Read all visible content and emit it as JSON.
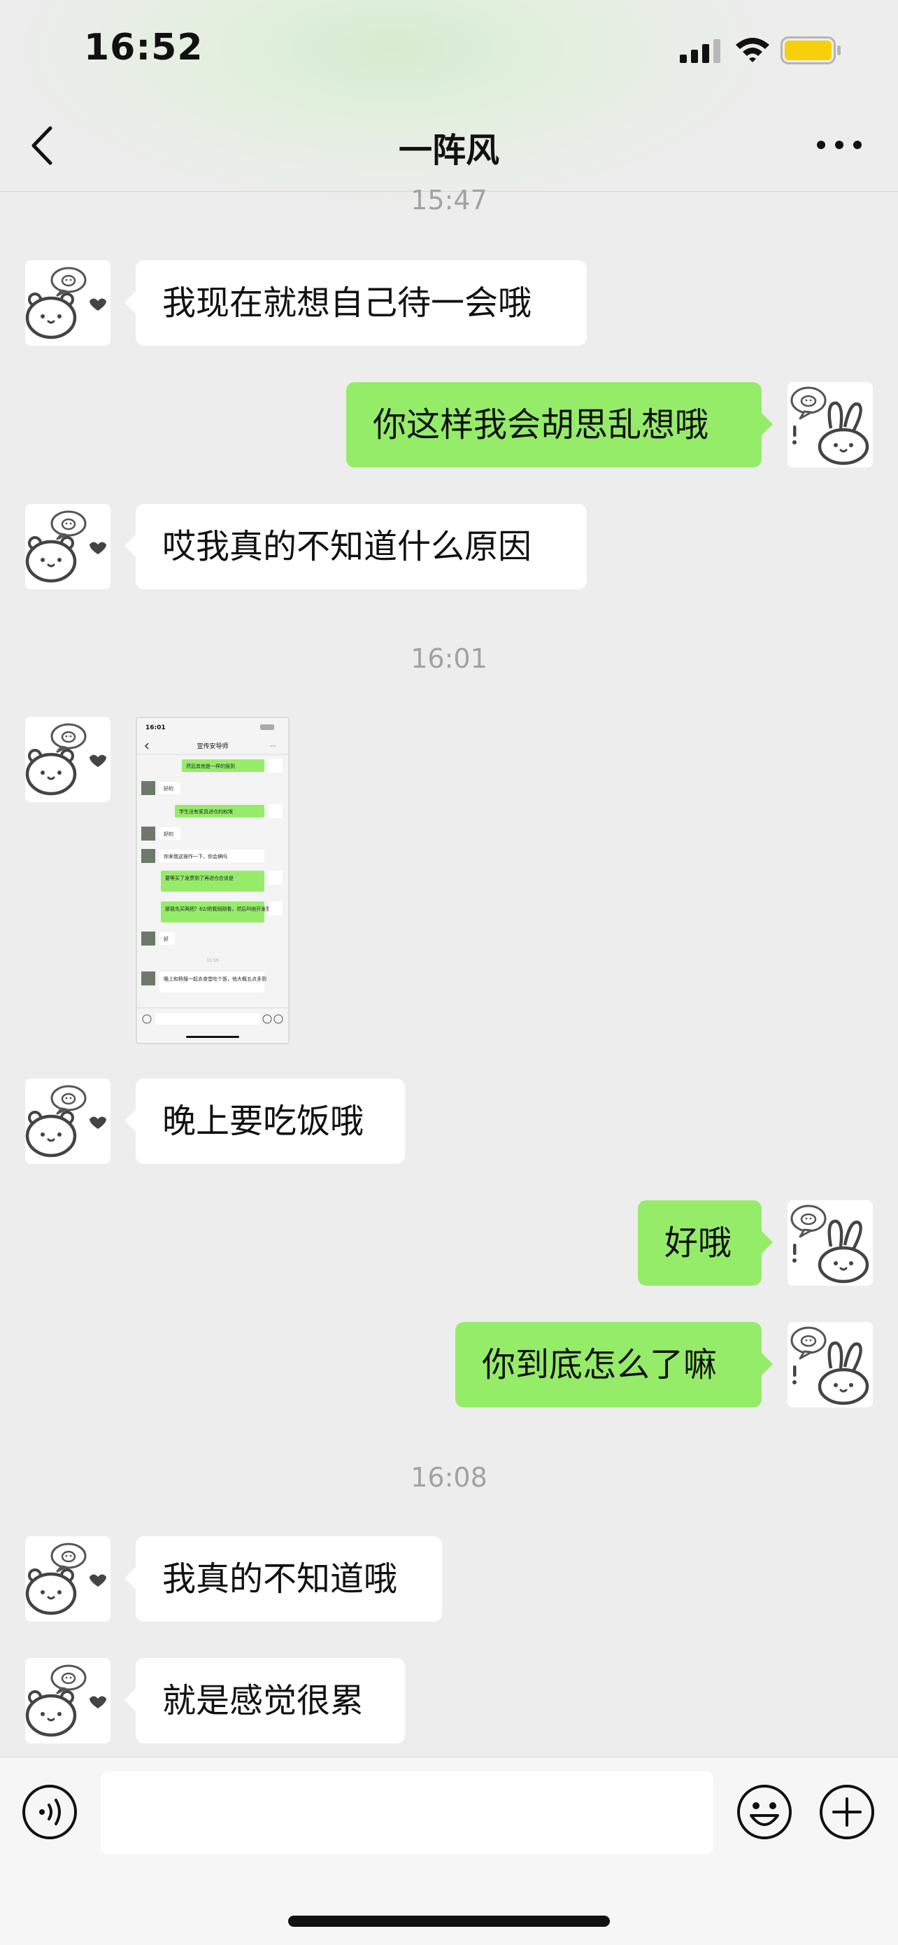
{
  "status_bar": {
    "time": "16:52"
  },
  "header": {
    "title": "一阵风"
  },
  "colors": {
    "incoming_bubble": "#ffffff",
    "outgoing_bubble": "#95ec69",
    "background": "#ededed",
    "timestamp": "#a2a2a2"
  },
  "messages": [
    {
      "type": "timestamp",
      "text": "15:47"
    },
    {
      "type": "incoming",
      "text": "我现在就想自己待一会哦"
    },
    {
      "type": "outgoing",
      "text": "你这样我会胡思乱想哦"
    },
    {
      "type": "incoming",
      "text": "哎我真的不知道什么原因"
    },
    {
      "type": "timestamp",
      "text": "16:01"
    },
    {
      "type": "incoming-image"
    },
    {
      "type": "incoming",
      "text": "晚上要吃饭哦"
    },
    {
      "type": "outgoing",
      "text": "好哦"
    },
    {
      "type": "outgoing",
      "text": "你到底怎么了嘛"
    },
    {
      "type": "timestamp",
      "text": "16:08"
    },
    {
      "type": "incoming",
      "text": "我真的不知道哦"
    },
    {
      "type": "incoming",
      "text": "就是感觉很累"
    }
  ],
  "screenshot_preview": {
    "time": "16:01",
    "title": "宣传安导师",
    "lines": [
      "然后其他是一样的报到",
      "好的",
      "学生没有家具进仓的权限",
      "好的",
      "你来我这操作一下，你会搞吗",
      "要等买了发票到了再进仓应该是",
      "那我先买两把？62/把我刚刚看，然后叫他开发票",
      "好",
      "15:59",
      "晚上和杨搜一起去食堂吃个饭，他大概五点多到"
    ]
  },
  "input_bar": {
    "placeholder": ""
  },
  "icons": {
    "back": "chevron-left-icon",
    "more": "ellipsis-icon",
    "voice": "voice-icon",
    "emoji": "emoji-icon",
    "plus": "plus-icon",
    "bear_avatar": "bear-icon",
    "bunny_avatar": "bunny-icon"
  }
}
